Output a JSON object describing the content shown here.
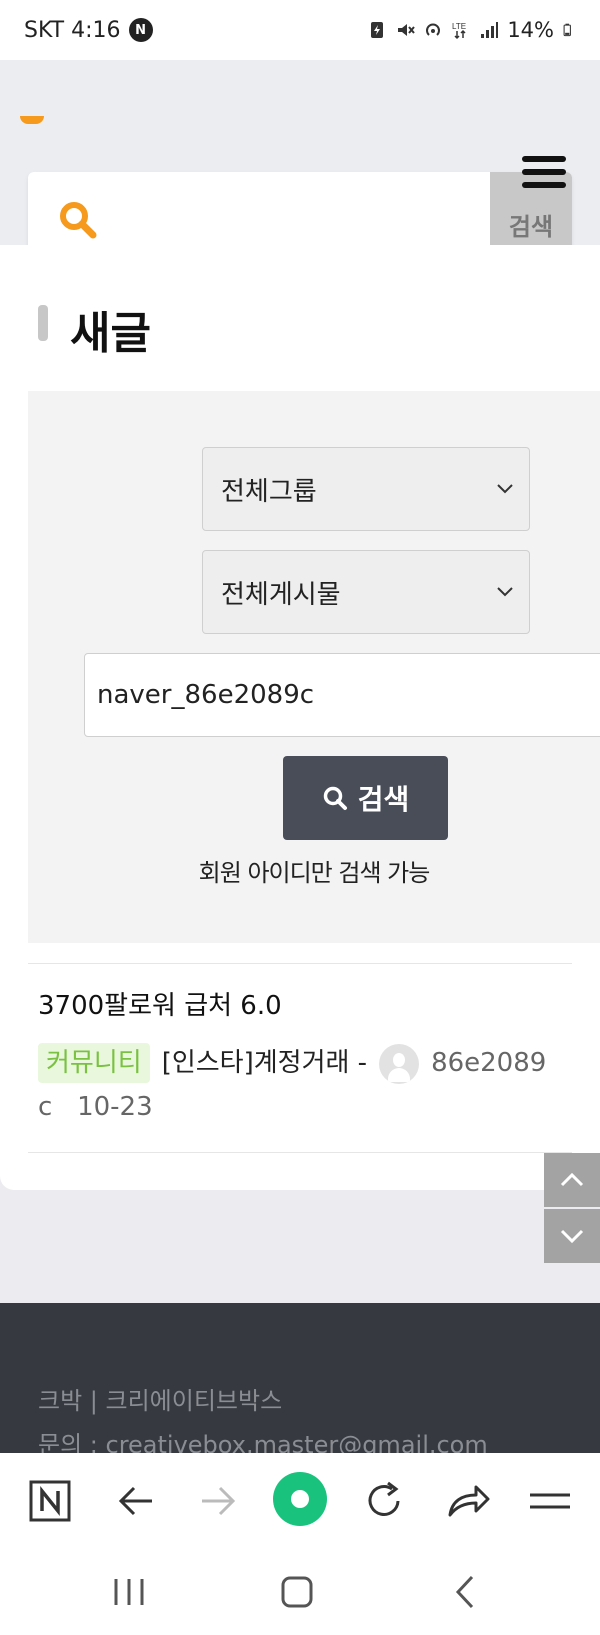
{
  "status_bar": {
    "carrier_time": "SKT 4:16",
    "n_badge": "N",
    "battery": "14%",
    "icons": [
      "battery-saver-icon",
      "mute-icon",
      "hotspot-icon",
      "lte-icon",
      "signal-icon",
      "battery-icon"
    ]
  },
  "header": {
    "search_placeholder": "",
    "search_button": "검색"
  },
  "main": {
    "title": "새글",
    "group_select": "전체그룹",
    "board_select": "전체게시물",
    "query_value": "naver_86e2089c",
    "submit_label": "검색",
    "hint": "회원 아이디만 검색 가능"
  },
  "post": {
    "title": "3700팔로워 급처 6.0",
    "category": "커뮤니티",
    "board": "[인스타]계정거래 -",
    "author": "86e2089",
    "author_tail": "c",
    "date": "10-23"
  },
  "footer": {
    "line1": "크박 | 크리에이티브박스",
    "line2": "문의 : creativebox.master@gmail.com"
  },
  "colors": {
    "accent_orange": "#f59a1c",
    "button_dark": "#484d58",
    "tag_green": "#7ac142",
    "footer_bg": "#36393f",
    "browser_green": "#19c37d"
  }
}
